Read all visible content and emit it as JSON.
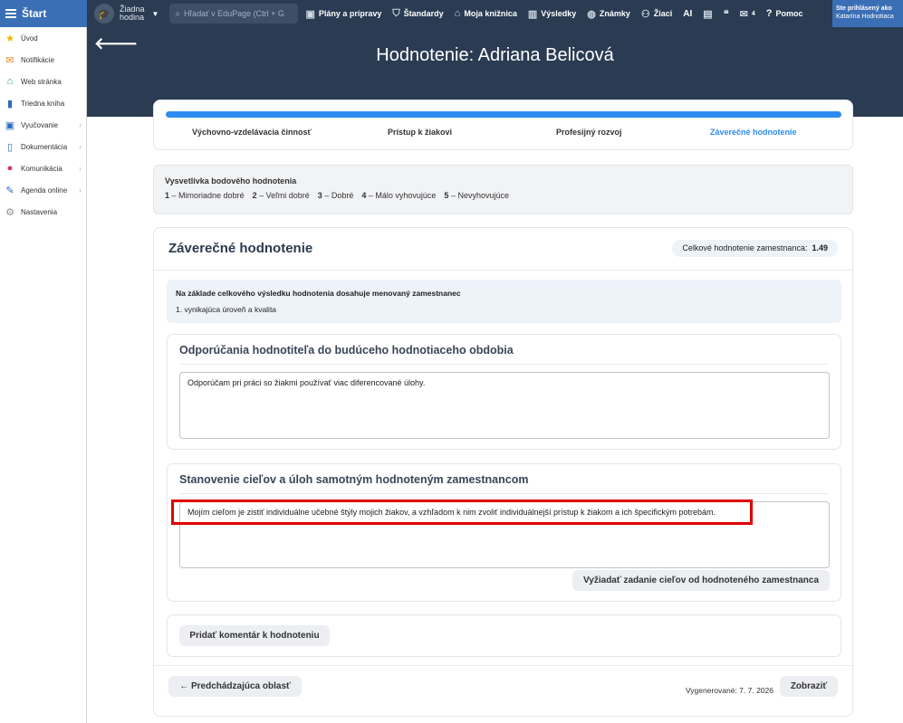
{
  "topbar": {
    "start_label": "Štart",
    "school_name_1": "Žiadna",
    "school_name_2": "hodina",
    "search_placeholder": "Hľadať v EduPage (Ctrl + G",
    "nav": [
      {
        "label": "Plány a prípravy",
        "icon": "briefcase-icon"
      },
      {
        "label": "Štandardy",
        "icon": "shield-icon"
      },
      {
        "label": "Moja knižnica",
        "icon": "library-icon"
      },
      {
        "label": "Výsledky",
        "icon": "bar-chart-icon"
      },
      {
        "label": "Známky",
        "icon": "grades-icon"
      },
      {
        "label": "Žiaci",
        "icon": "students-icon"
      },
      {
        "label": "AI",
        "icon": ""
      },
      {
        "label": "",
        "icon": "presentation-icon"
      },
      {
        "label": "",
        "icon": "chat-icon"
      },
      {
        "label": "4",
        "icon": "mail-icon"
      },
      {
        "label": "Pomoc",
        "icon": "help-icon"
      }
    ],
    "user_line1": "Ste prihlásený ako",
    "user_line2": "Katarína Hodnotiaca"
  },
  "sidebar": {
    "items": [
      {
        "label": "Úvod",
        "icon": "star-icon",
        "color": "#f0b400"
      },
      {
        "label": "Notifikácie",
        "icon": "mail-icon",
        "color": "#f08a24"
      },
      {
        "label": "Web stránka",
        "icon": "home-icon",
        "color": "#1fa67a"
      },
      {
        "label": "Triedna kniha",
        "icon": "book-icon",
        "color": "#2d6cc0"
      },
      {
        "label": "Vyučovanie",
        "icon": "briefcase-icon",
        "color": "#2d6cc0",
        "chevron": true
      },
      {
        "label": "Dokumentácia",
        "icon": "document-icon",
        "color": "#2d6cc0",
        "chevron": true
      },
      {
        "label": "Komunikácia",
        "icon": "chat-icon",
        "color": "#d2335c",
        "chevron": true
      },
      {
        "label": "Agenda online",
        "icon": "pencil-icon",
        "color": "#2d6cc0",
        "chevron": true
      },
      {
        "label": "Nastavenia",
        "icon": "gear-icon",
        "color": "#8a8f96"
      }
    ]
  },
  "page": {
    "title": "Hodnotenie: Adriana Belicová"
  },
  "tabs": [
    {
      "label": "Výchovno-vzdelávacia činnosť"
    },
    {
      "label": "Prístup k žiakovi"
    },
    {
      "label": "Profesijný rozvoj"
    },
    {
      "label": "Záverečné hodnotenie"
    }
  ],
  "progress_fraction": 1.0,
  "legend": {
    "title": "Vysvetlivka bodového hodnotenia",
    "items": [
      {
        "num": "1",
        "text": "– Mimoriadne dobré"
      },
      {
        "num": "2",
        "text": "– Veľmi dobré"
      },
      {
        "num": "3",
        "text": "– Dobré"
      },
      {
        "num": "4",
        "text": "– Málo vyhovujúce"
      },
      {
        "num": "5",
        "text": "– Nevyhovujúce"
      }
    ]
  },
  "main": {
    "title": "Záverečné hodnotenie",
    "score_label": "Celkové hodnotenie zamestnanca:",
    "score_value": "1.49",
    "info_line1": "Na základe celkového výsledku hodnotenia dosahuje menovaný zamestnanec",
    "info_line2": "1. vynikajúca úroveň a kvalita",
    "rec_title": "Odporúčania hodnotiteľa do budúceho hodnotiaceho obdobia",
    "rec_text": "Odporúčam pri práci so žiakmi používať viac diferencované úlohy.",
    "goals_title": "Stanovenie cieľov a úloh samotným hodnoteným zamestnancom",
    "goals_text": "Mojím cieľom je zistiť individuálne učebné štýly mojich žiakov, a vzhľadom k nim zvoliť individuálnejší prístup k žiakom a ich špecifickým potrebám.",
    "request_btn": "Vyžiadať zadanie cieľov od hodnoteného zamestnanca",
    "comment_btn": "Pridať komentár k hodnoteniu",
    "prev_btn": "← Predchádzajúca oblasť",
    "generated": "Vygenerované: 7. 7. 2026",
    "show_btn": "Zobraziť"
  },
  "colors": {
    "accent": "#2d8cf0",
    "header_bg": "#2a3b52",
    "highlight": "#e00000"
  }
}
